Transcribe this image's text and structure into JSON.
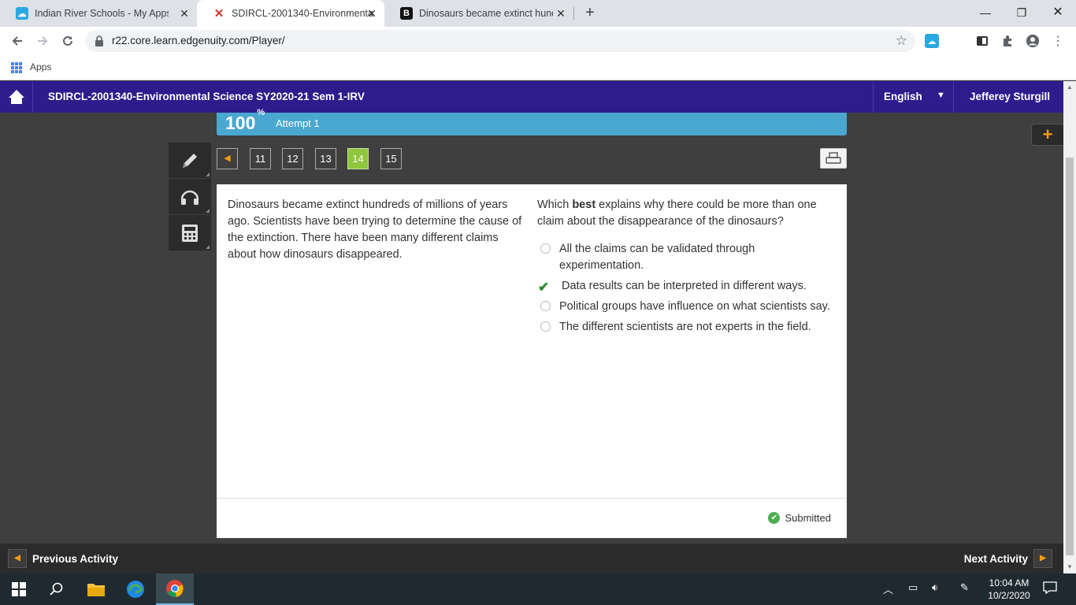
{
  "browser": {
    "tabs": [
      {
        "title": "Indian River Schools - My Apps",
        "favicon": "cloud-icon"
      },
      {
        "title": "SDIRCL-2001340-Environmental",
        "favicon": "edgenuity-icon"
      },
      {
        "title": "Dinosaurs became extinct hundre",
        "favicon": "brainly-icon"
      }
    ],
    "url": "r22.core.learn.edgenuity.com/Player/",
    "bookmarks": {
      "apps_label": "Apps"
    }
  },
  "header": {
    "course_title": "SDIRCL-2001340-Environmental Science SY2020-21 Sem 1-IRV",
    "language": "English",
    "user_name": "Jefferey Sturgill"
  },
  "progress": {
    "percent": "100",
    "percent_sign": "%",
    "attempt": "Attempt 1"
  },
  "question_nav": {
    "prev_glyph": "◀",
    "numbers": [
      "11",
      "12",
      "13",
      "14",
      "15"
    ],
    "current": "14"
  },
  "content": {
    "passage": "Dinosaurs became extinct hundreds of millions of years ago. Scientists have been trying to determine the cause of the extinction. There have been many different claims about how dinosaurs disappeared.",
    "question_prefix": "Which ",
    "question_bold": "best",
    "question_suffix": " explains why there could be more than one claim about the disappearance of the dinosaurs?",
    "options": [
      "All the claims can be validated through experimentation.",
      "Data results can be interpreted in different ways.",
      "Political groups have influence on what scientists say.",
      "The different scientists are not experts in the field."
    ],
    "selected_index": 1,
    "status": "Submitted"
  },
  "activity_nav": {
    "previous": "Previous Activity",
    "next": "Next Activity"
  },
  "taskbar": {
    "time": "10:04 AM",
    "date": "10/2/2020"
  },
  "colors": {
    "header_bg": "#2f1c8c",
    "progress_bg": "#4aa7d0",
    "current_question": "#8fc63e",
    "accent_orange": "#f39c12",
    "check_green": "#2e8b2e"
  }
}
